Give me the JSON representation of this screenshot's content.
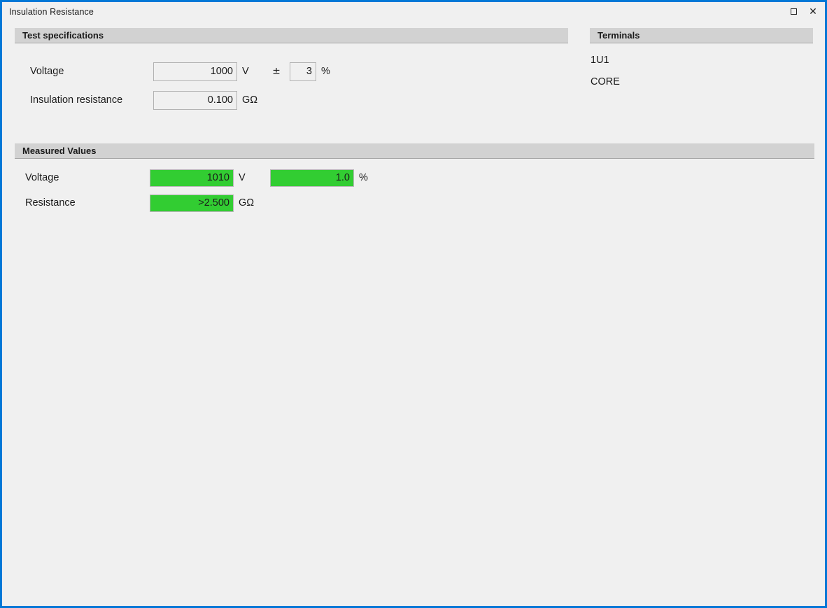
{
  "window": {
    "title": "Insulation Resistance",
    "border_color": "#0078d7",
    "background_color": "#f0f0f0",
    "controls": {
      "maximize_label": "Maximize",
      "close_label": "Close",
      "close_glyph": "✕"
    }
  },
  "test_specifications": {
    "header": "Test specifications",
    "rows": [
      {
        "label": "Voltage",
        "value": "1000",
        "placeholder": "0",
        "unit": "V",
        "tolerance_symbol": "±",
        "tolerance_value": "3",
        "tolerance_placeholder": "0",
        "tolerance_unit": "%"
      },
      {
        "label": "Insulation resistance",
        "value": "0.100",
        "placeholder": "0.000",
        "unit": "GΩ"
      }
    ]
  },
  "terminals": {
    "header": "Terminals",
    "items": [
      "1U1",
      "CORE"
    ]
  },
  "measured_values": {
    "header": "Measured Values",
    "pass_color": "#32cd32",
    "rows": [
      {
        "label": "Voltage",
        "value": "1010",
        "unit": "V",
        "tolerance_value": "1.0",
        "tolerance_unit": "%"
      },
      {
        "label": "Resistance",
        "value": ">2.500",
        "unit": "GΩ"
      }
    ]
  }
}
